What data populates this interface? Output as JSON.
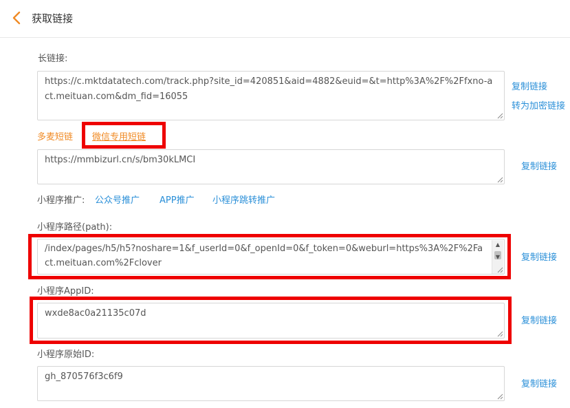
{
  "header": {
    "title": "获取链接"
  },
  "long_link": {
    "label": "长链接:",
    "value": "https://c.mktdatatech.com/track.php?site_id=420851&aid=4882&euid=&t=http%3A%2F%2Ffxno-act.meituan.com&dm_fid=16055",
    "copy_label": "复制链接",
    "encrypt_label": "转为加密链接"
  },
  "short_tabs": [
    {
      "label": "多麦短链",
      "active": false
    },
    {
      "label": "微信专用短链",
      "active": true
    }
  ],
  "short_link": {
    "value": "https://mmbizurl.cn/s/bm30kLMCI",
    "copy_label": "复制链接"
  },
  "promo": {
    "label": "小程序推广:",
    "links": [
      "公众号推广",
      "APP推广",
      "小程序跳转推广"
    ]
  },
  "path": {
    "label": "小程序路径(path):",
    "value": "/index/pages/h5/h5?noshare=1&f_userId=0&f_openId=0&f_token=0&weburl=https%3A%2F%2Fact.meituan.com%2Fclover",
    "copy_label": "复制链接"
  },
  "appid": {
    "label": "小程序AppID:",
    "value": "wxde8ac0a21135c07d",
    "copy_label": "复制链接"
  },
  "origin_id": {
    "label": "小程序原始ID:",
    "value": "gh_870576f3c6f9",
    "copy_label": "复制链接"
  },
  "colors": {
    "accent_orange": "#f08a24",
    "link_blue": "#2a8fd8",
    "highlight_red": "#ee0000"
  },
  "icons": {
    "back": "chevron-left-icon",
    "resize": "resize-grip-icon"
  }
}
